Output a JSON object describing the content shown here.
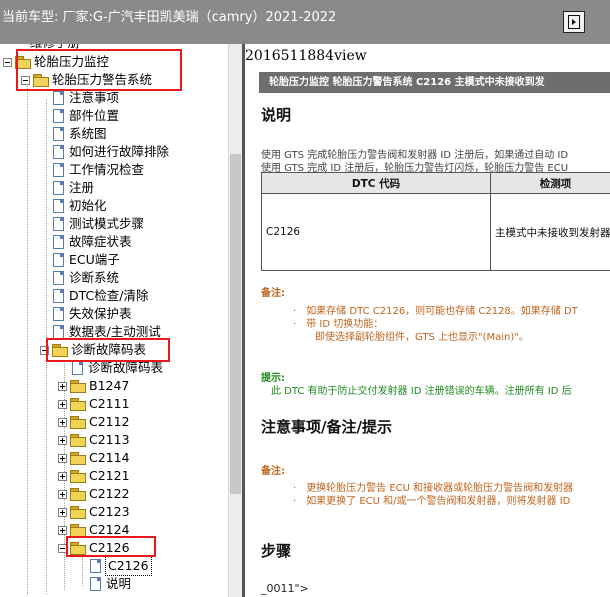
{
  "header": {
    "title": "当前车型:   厂家:G-广汽丰田凯美瑞（camry）2021-2022"
  },
  "tree": {
    "clipped_label": "维修手册",
    "items": [
      {
        "label": "轮胎压力监控"
      },
      {
        "label": "轮胎压力警告系统"
      },
      {
        "label": "注意事项"
      },
      {
        "label": "部件位置"
      },
      {
        "label": "系统图"
      },
      {
        "label": "如何进行故障排除"
      },
      {
        "label": "工作情况检查"
      },
      {
        "label": "注册"
      },
      {
        "label": "初始化"
      },
      {
        "label": "测试模式步骤"
      },
      {
        "label": "故障症状表"
      },
      {
        "label": "ECU端子"
      },
      {
        "label": "诊断系统"
      },
      {
        "label": "DTC检查/清除"
      },
      {
        "label": "失效保护表"
      },
      {
        "label": "数据表/主动测试"
      },
      {
        "label": "诊断故障码表"
      },
      {
        "label": "诊断故障码表"
      },
      {
        "label": "B1247"
      },
      {
        "label": "C2111"
      },
      {
        "label": "C2112"
      },
      {
        "label": "C2113"
      },
      {
        "label": "C2114"
      },
      {
        "label": "C2121"
      },
      {
        "label": "C2122"
      },
      {
        "label": "C2123"
      },
      {
        "label": "C2124"
      },
      {
        "label": "C2126"
      },
      {
        "label": "C2126"
      },
      {
        "label": "说明"
      }
    ]
  },
  "content": {
    "view_id": "2016511884view",
    "banner": "轮胎压力监控  轮胎压力警告系统  C2126  主模式中未接收到发",
    "section_desc": "说明",
    "desc_line1": "使用 GTS 完成轮胎压力警告阀和发射器 ID 注册后，如果通过自动 ID",
    "desc_line2": "使用 GTS 完成 ID 注册后，轮胎压力警告灯闪烁，轮胎压力警告 ECU",
    "table": {
      "headers": [
        "DTC 代码",
        "检测项"
      ],
      "row": [
        "C2126",
        "主模式中未接收到发射器"
      ]
    },
    "note_label": "备注:",
    "note1_line1": "如果存储 DTC C2126，则可能也存储 C2128。如果存储 DT",
    "note1_line2": "带 ID 切换功能：",
    "note1_line3": "即使选择副轮胎组件，GTS 上也显示\"(Main)\"。",
    "tip_label": "提示:",
    "tip_line": "此 DTC 有助于防止交付发射器 ID 注册错误的车辆。注册所有 ID 后",
    "section_notes": "注意事项/备注/提示",
    "note2_label": "备注:",
    "note2_line1": "更换轮胎压力警告 ECU 和接收器或轮胎压力警告阀和发射器",
    "note2_line2": "如果更换了 ECU 和/或一个警告阀和发射器，则将发射器 ID",
    "section_steps": "步骤",
    "code_tail": "_0011\">"
  },
  "colors": {
    "highlight_box": "#e8191b",
    "note_text": "#c0641e",
    "tip_text": "#1e8a1e",
    "banner_bg": "#6e6e6e",
    "titlebar_bg": "#8a8a8a"
  }
}
